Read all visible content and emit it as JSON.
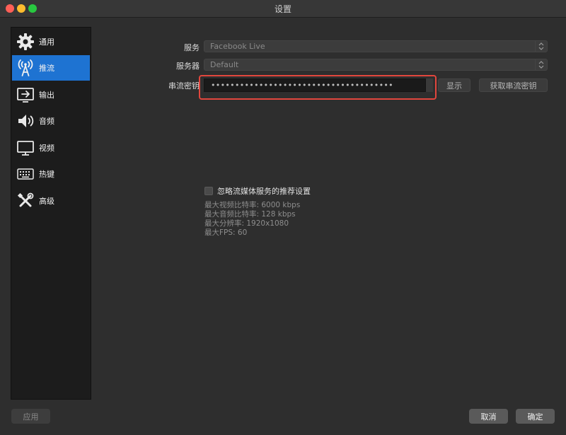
{
  "window": {
    "title": "设置"
  },
  "sidebar": {
    "items": [
      {
        "label": "通用",
        "icon": "gear-icon"
      },
      {
        "label": "推流",
        "icon": "broadcast-icon"
      },
      {
        "label": "输出",
        "icon": "output-icon"
      },
      {
        "label": "音频",
        "icon": "speaker-icon"
      },
      {
        "label": "视频",
        "icon": "monitor-icon"
      },
      {
        "label": "热键",
        "icon": "keyboard-icon"
      },
      {
        "label": "高级",
        "icon": "tools-icon"
      }
    ],
    "active_index": 1
  },
  "stream": {
    "service_label": "服务",
    "service_value": "Facebook Live",
    "server_label": "服务器",
    "server_value": "Default",
    "key_label": "串流密钥",
    "key_value": "••••••••••••••••••••••••••••••••••••••",
    "show_button": "显示",
    "get_key_button": "获取串流密钥",
    "ignore_checkbox_label": "忽略流媒体服务的推荐设置",
    "ignore_checked": false,
    "info": {
      "video_bitrate": "最大视频比特率: 6000 kbps",
      "audio_bitrate": "最大音频比特率: 128 kbps",
      "resolution": "最大分辨率:  1920x1080",
      "fps": "最大FPS:  60"
    }
  },
  "footer": {
    "apply": "应用",
    "cancel": "取消",
    "ok": "确定"
  },
  "colors": {
    "accent": "#1e73d2",
    "highlight": "#e2463d"
  }
}
